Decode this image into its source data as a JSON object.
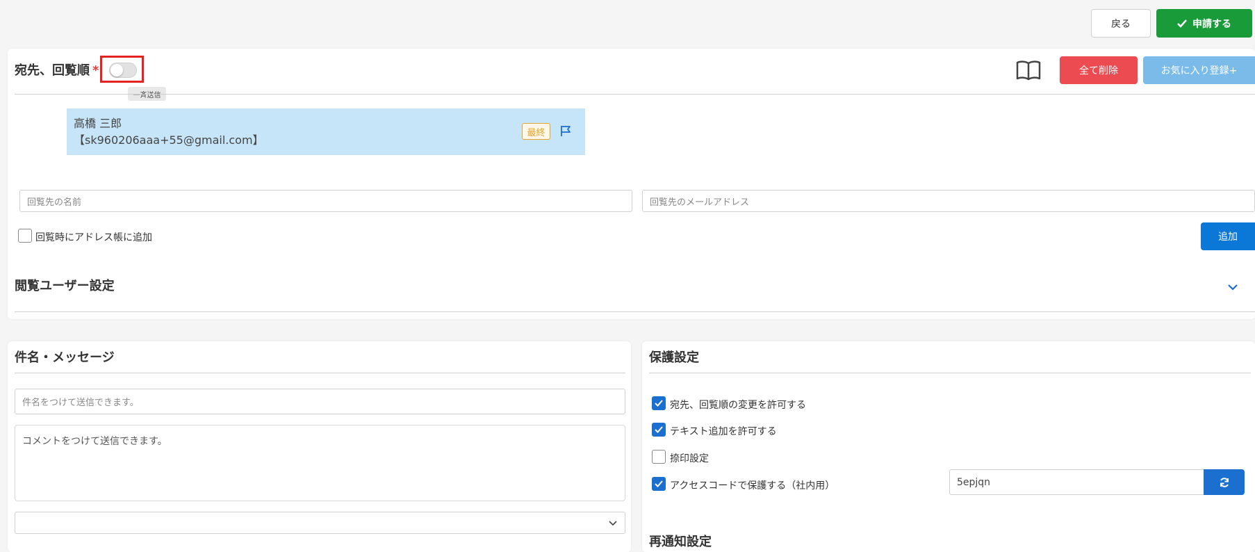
{
  "header": {
    "back_label": "戻る",
    "apply_label": "申請する"
  },
  "recipients_section": {
    "title": "宛先、回覧順",
    "required_mark": "*",
    "toggle_tooltip": "一斉送信",
    "delete_all_label": "全て削除",
    "favorite_label": "お気に入り登録+",
    "recipient": {
      "name": "高橋 三郎",
      "email": "【sk960206aaa+55@gmail.com】",
      "badge": "最終"
    },
    "name_input_placeholder": "回覧先の名前",
    "email_input_placeholder": "回覧先のメールアドレス",
    "addressbook_checkbox_label": "回覧時にアドレス帳に追加",
    "add_button_label": "追加",
    "viewer_settings_title": "閲覧ユーザー設定"
  },
  "subject_section": {
    "title": "件名・メッセージ",
    "subject_placeholder": "件名をつけて送信できます。",
    "comment_placeholder": "コメントをつけて送信できます。"
  },
  "protection_section": {
    "title": "保護設定",
    "options": [
      {
        "label": "宛先、回覧順の変更を許可する",
        "checked": true
      },
      {
        "label": "テキスト追加を許可する",
        "checked": true
      },
      {
        "label": "捺印設定",
        "checked": false
      },
      {
        "label": "アクセスコードで保護する（社内用）",
        "checked": true
      }
    ],
    "access_code": "5epjqn",
    "renotify_title": "再通知設定"
  },
  "colors": {
    "apply_green": "#1a9b3a",
    "delete_red": "#ec4b52",
    "favorite_blue": "#7bbbe9",
    "add_blue": "#0b78d7",
    "recipient_bg": "#c7e5f8",
    "badge_orange": "#e3a52a"
  }
}
